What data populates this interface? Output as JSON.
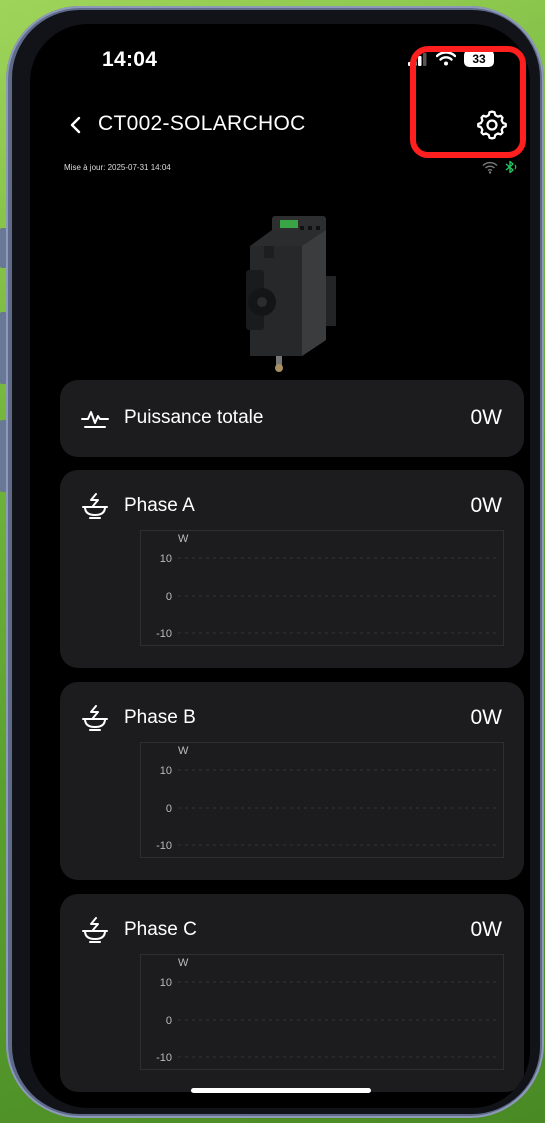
{
  "status_bar": {
    "time": "14:04",
    "battery": "33"
  },
  "header": {
    "title": "CT002-SOLARCHOC",
    "updated": "Mise à jour: 2025-07-31 14:04"
  },
  "total": {
    "label": "Puissance totale",
    "value": "0W"
  },
  "phases": [
    {
      "label": "Phase A",
      "value": "0W",
      "unit": "W",
      "ticks": [
        "10",
        "0",
        "-10"
      ]
    },
    {
      "label": "Phase B",
      "value": "0W",
      "unit": "W",
      "ticks": [
        "10",
        "0",
        "-10"
      ]
    },
    {
      "label": "Phase C",
      "value": "0W",
      "unit": "W",
      "ticks": [
        "10",
        "0",
        "-10"
      ]
    }
  ],
  "colors": {
    "highlight": "#ff1f1f",
    "card": "#1c1c1e",
    "bluetooth": "#22c55e"
  }
}
